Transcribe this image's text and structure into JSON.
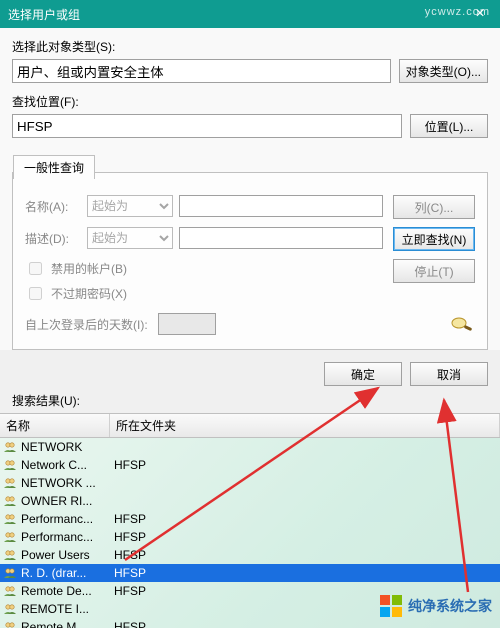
{
  "titlebar": {
    "title": "选择用户或组",
    "close": "×"
  },
  "watermark_url": "ycwwz.com",
  "object_type": {
    "label": "选择此对象类型(S):",
    "value": "用户、组或内置安全主体",
    "button": "对象类型(O)..."
  },
  "location": {
    "label": "查找位置(F):",
    "value": "HFSP",
    "button": "位置(L)..."
  },
  "tab_label": "一般性查询",
  "query": {
    "name_label": "名称(A):",
    "name_op": "起始为",
    "desc_label": "描述(D):",
    "desc_op": "起始为",
    "disabled_accounts": "禁用的帐户(B)",
    "never_expire": "不过期密码(X)",
    "days_label": "自上次登录后的天数(I):"
  },
  "side_buttons": {
    "columns": "列(C)...",
    "find_now": "立即查找(N)",
    "stop": "停止(T)"
  },
  "ok": "确定",
  "cancel": "取消",
  "results_label": "搜索结果(U):",
  "grid": {
    "col_name": "名称",
    "col_folder": "所在文件夹",
    "rows": [
      {
        "name": "NETWORK",
        "folder": ""
      },
      {
        "name": "Network C...",
        "folder": "HFSP"
      },
      {
        "name": "NETWORK ...",
        "folder": ""
      },
      {
        "name": "OWNER RI...",
        "folder": ""
      },
      {
        "name": "Performanc...",
        "folder": "HFSP"
      },
      {
        "name": "Performanc...",
        "folder": "HFSP"
      },
      {
        "name": "Power Users",
        "folder": "HFSP"
      },
      {
        "name": "R. D. (drar...",
        "folder": "HFSP",
        "selected": true
      },
      {
        "name": "Remote De...",
        "folder": "HFSP"
      },
      {
        "name": "REMOTE I...",
        "folder": ""
      },
      {
        "name": "Remote M...",
        "folder": "HFSP"
      }
    ]
  },
  "footer_brand": "纯净系统之家"
}
